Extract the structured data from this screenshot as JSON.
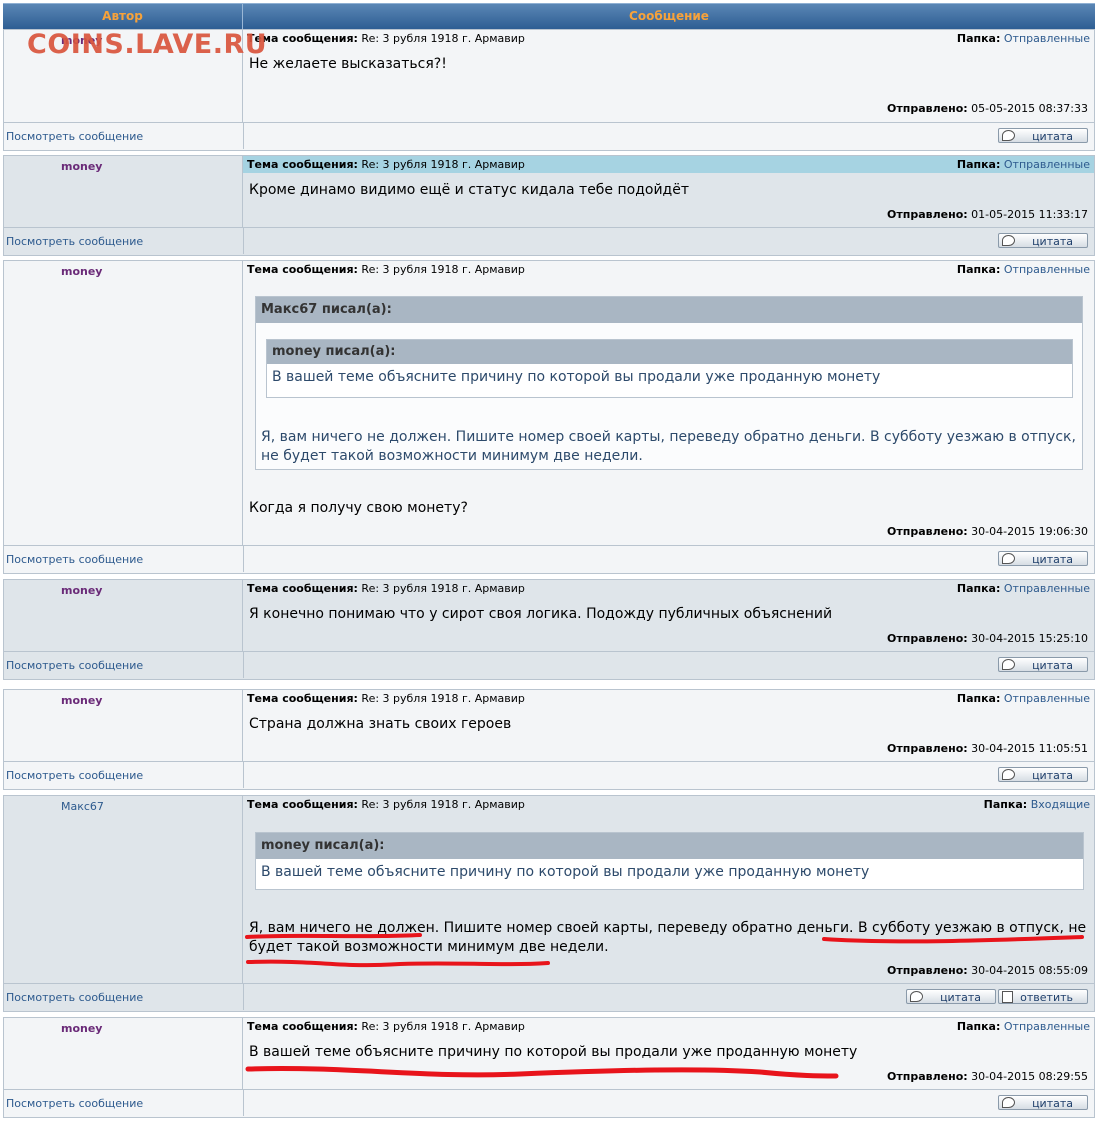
{
  "header": {
    "author_col": "Автор",
    "message_col": "Сообщение"
  },
  "watermark": "COINS.LAVE.RU",
  "labels": {
    "subject": "Тема сообщения:",
    "folder": "Папка:",
    "sent": "Отправлено:",
    "view": "Посмотреть сообщение",
    "quote_btn": "цитата",
    "reply_btn": "ответить",
    "wrote_money": "money писал(а):",
    "wrote_maks": "Макс67 писал(а):"
  },
  "subject_text": "Re: 3 рубля 1918 г. Армавир",
  "posts": [
    {
      "author": "money",
      "folder": "Отправленные",
      "body": "Не желаете высказаться?!",
      "sent": "05-05-2015 08:37:33"
    },
    {
      "author": "money",
      "folder": "Отправленные",
      "body": "Кроме динамо видимо ещё и статус кидала тебе подойдёт",
      "sent": "01-05-2015 11:33:17"
    },
    {
      "author": "money",
      "folder": "Отправленные",
      "body": "Когда я получу свою монету?",
      "sent": "30-04-2015 19:06:30",
      "quote_outer": "Я, вам ничего не должен. Пишите номер своей карты, переведу обратно деньги. В субботу уезжаю в отпуск, не будет такой возможности минимум две недели.",
      "quote_inner": "В вашей теме объясните причину по которой вы продали уже проданную монету"
    },
    {
      "author": "money",
      "folder": "Отправленные",
      "body": "Я конечно понимаю что у сирот своя логика. Подожду публичных объяснений",
      "sent": "30-04-2015 15:25:10"
    },
    {
      "author": "money",
      "folder": "Отправленные",
      "body": "Страна должна знать своих героев",
      "sent": "30-04-2015 11:05:51"
    },
    {
      "author": "Макс67",
      "folder": "Входящие",
      "body": "Я, вам ничего не должен. Пишите номер своей карты, переведу обратно деньги. В субботу уезжаю в отпуск, не будет такой возможности минимум две недели.",
      "sent": "30-04-2015 08:55:09",
      "quote_inner": "В вашей теме объясните причину по которой вы продали уже проданную монету"
    },
    {
      "author": "money",
      "folder": "Отправленные",
      "body": "В вашей теме объясните причину по которой вы продали уже проданную монету",
      "sent": "30-04-2015 08:29:55"
    }
  ],
  "colors": {
    "accent": "#2e5e93",
    "header_text": "#f7a23a",
    "author": "#6a2a78",
    "link": "#2d5a8e",
    "highlight": "#a6d3e2",
    "annotation": "#e8141b"
  }
}
